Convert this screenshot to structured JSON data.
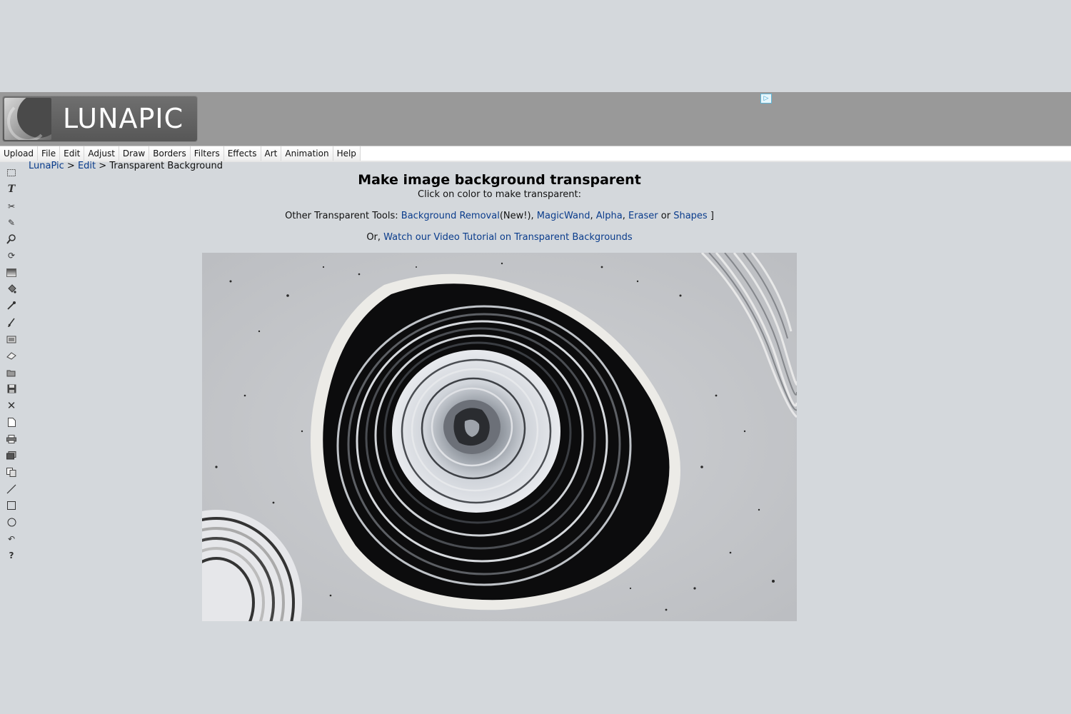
{
  "header": {
    "logo_text": "LUNAPIC",
    "ad_icon": "adchoices-icon"
  },
  "menu": [
    "Upload",
    "File",
    "Edit",
    "Adjust",
    "Draw",
    "Borders",
    "Filters",
    "Effects",
    "Art",
    "Animation",
    "Help"
  ],
  "toolbar": {
    "icons": [
      "select-icon",
      "text-icon",
      "scissors-icon",
      "pencil-icon",
      "zoom-icon",
      "rotate-icon",
      "gradient-icon",
      "paint-bucket-icon",
      "eyedropper-icon",
      "brush-icon",
      "crop-icon",
      "eraser-icon",
      "open-icon",
      "save-icon",
      "close-icon",
      "new-icon",
      "print-icon",
      "layers-icon",
      "copy-icon",
      "line-icon",
      "rectangle-icon",
      "circle-icon",
      "undo-icon",
      "help-icon"
    ]
  },
  "breadcrumb": {
    "home": "LunaPic",
    "sep1": " > ",
    "section": "Edit",
    "sep2": " > ",
    "current": "Transparent Background"
  },
  "main": {
    "title": "Make image background transparent",
    "subtitle": "Click on color to make transparent:",
    "tools_prefix": "Other Transparent Tools: ",
    "link_bg_removal": "Background Removal",
    "new_tag": "(New!), ",
    "link_magicwand": "MagicWand",
    "comma1": ", ",
    "link_alpha": "Alpha",
    "comma2": ", ",
    "link_eraser": "Eraser",
    "or_text": " or ",
    "link_shapes": "Shapes",
    "close_bracket": " ]",
    "video_prefix": "Or, ",
    "video_link": "Watch our Video Tutorial on Transparent Backgrounds"
  },
  "image": {
    "description_colors": {
      "background": "#c6c8cb",
      "swirl": "#111111",
      "rim": "#eeeeee"
    }
  }
}
